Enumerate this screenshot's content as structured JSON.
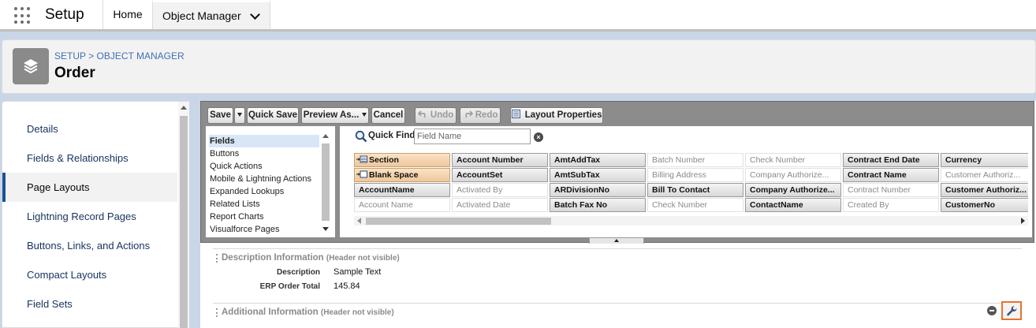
{
  "topnav": {
    "app_name": "Setup",
    "tabs": [
      {
        "label": "Home"
      },
      {
        "label": "Object Manager"
      }
    ]
  },
  "header": {
    "breadcrumb_setup": "SETUP",
    "breadcrumb_sep": ">",
    "breadcrumb_om": "OBJECT MANAGER",
    "title": "Order"
  },
  "sidebar": {
    "items": [
      {
        "label": "Details"
      },
      {
        "label": "Fields & Relationships"
      },
      {
        "label": "Page Layouts",
        "active": true
      },
      {
        "label": "Lightning Record Pages"
      },
      {
        "label": "Buttons, Links, and Actions"
      },
      {
        "label": "Compact Layouts"
      },
      {
        "label": "Field Sets"
      }
    ]
  },
  "toolbar": {
    "save": "Save",
    "quick_save": "Quick Save",
    "preview_as": "Preview As...",
    "cancel": "Cancel",
    "undo": "Undo",
    "redo": "Redo",
    "layout_properties": "Layout Properties"
  },
  "palette": {
    "categories": [
      "Fields",
      "Buttons",
      "Quick Actions",
      "Mobile & Lightning Actions",
      "Expanded Lookups",
      "Related Lists",
      "Report Charts",
      "Visualforce Pages"
    ],
    "quick_find_label": "Quick Find",
    "quick_find_placeholder": "Field Name",
    "fields": [
      [
        {
          "label": "Section",
          "kind": "special"
        },
        {
          "label": "Account Number",
          "kind": "avail"
        },
        {
          "label": "AmtAddTax",
          "kind": "avail"
        },
        {
          "label": "Batch Number",
          "kind": "used"
        },
        {
          "label": "Check Number",
          "kind": "used"
        },
        {
          "label": "Contract End Date",
          "kind": "avail"
        },
        {
          "label": "Currency",
          "kind": "avail"
        }
      ],
      [
        {
          "label": "Blank Space",
          "kind": "special"
        },
        {
          "label": "AccountSet",
          "kind": "avail"
        },
        {
          "label": "AmtSubTax",
          "kind": "avail"
        },
        {
          "label": "Billing Address",
          "kind": "used"
        },
        {
          "label": "Company Authorize...",
          "kind": "used"
        },
        {
          "label": "Contract Name",
          "kind": "avail"
        },
        {
          "label": "Customer Authoriz...",
          "kind": "used"
        }
      ],
      [
        {
          "label": "AccountName",
          "kind": "avail"
        },
        {
          "label": "Activated By",
          "kind": "used"
        },
        {
          "label": "ARDivisionNo",
          "kind": "avail"
        },
        {
          "label": "Bill To Contact",
          "kind": "avail"
        },
        {
          "label": "Company Authorize...",
          "kind": "avail"
        },
        {
          "label": "Contract Number",
          "kind": "used"
        },
        {
          "label": "Customer Authoriz...",
          "kind": "avail"
        }
      ],
      [
        {
          "label": "Account Name",
          "kind": "used"
        },
        {
          "label": "Activated Date",
          "kind": "used"
        },
        {
          "label": "Batch Fax No",
          "kind": "avail"
        },
        {
          "label": "Check Number",
          "kind": "used"
        },
        {
          "label": "ContactName",
          "kind": "avail"
        },
        {
          "label": "Created By",
          "kind": "used"
        },
        {
          "label": "CustomerNo",
          "kind": "avail"
        }
      ]
    ]
  },
  "layout": {
    "description_section": {
      "title": "Description Information",
      "hint": "(Header not visible)",
      "rows": [
        {
          "label": "Description",
          "value": "Sample Text"
        },
        {
          "label": "ERP Order Total",
          "value": "145.84"
        }
      ]
    },
    "additional_section": {
      "title": "Additional Information",
      "hint": "(Header not visible)"
    }
  }
}
